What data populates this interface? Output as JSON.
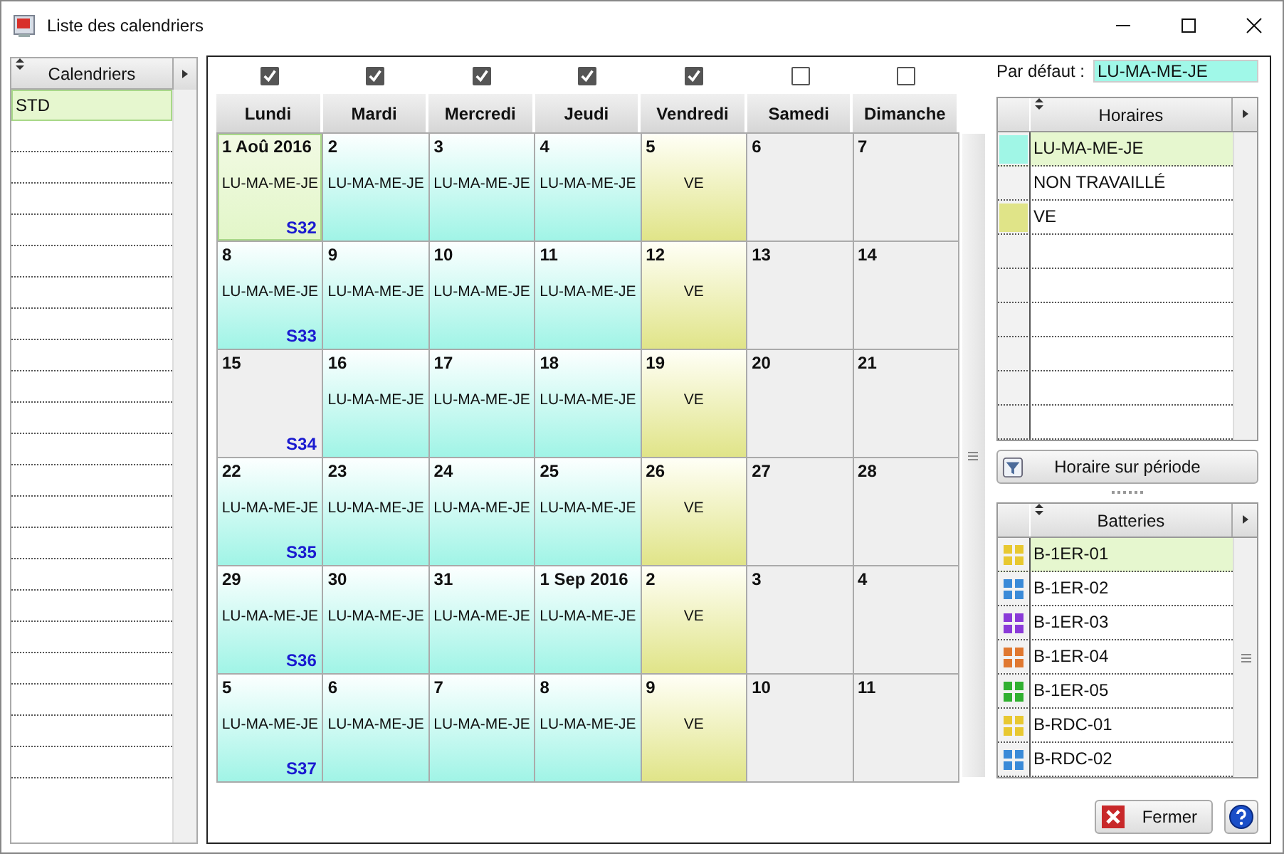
{
  "window": {
    "title": "Liste des calendriers"
  },
  "calendars": {
    "header": "Calendriers",
    "items": [
      {
        "label": "STD",
        "selected": true
      }
    ]
  },
  "weekdays": [
    {
      "label": "Lundi",
      "checked": true
    },
    {
      "label": "Mardi",
      "checked": true
    },
    {
      "label": "Mercredi",
      "checked": true
    },
    {
      "label": "Jeudi",
      "checked": true
    },
    {
      "label": "Vendredi",
      "checked": true
    },
    {
      "label": "Samedi",
      "checked": false
    },
    {
      "label": "Dimanche",
      "checked": false
    }
  ],
  "weeks": [
    {
      "week": "S32",
      "days": [
        {
          "date": "1 Aoû 2016",
          "schedule": "LU-MA-ME-JE",
          "kind": "work",
          "selected": true
        },
        {
          "date": "2",
          "schedule": "LU-MA-ME-JE",
          "kind": "work",
          "selected": false
        },
        {
          "date": "3",
          "schedule": "LU-MA-ME-JE",
          "kind": "work",
          "selected": false
        },
        {
          "date": "4",
          "schedule": "LU-MA-ME-JE",
          "kind": "work",
          "selected": false
        },
        {
          "date": "5",
          "schedule": "VE",
          "kind": "friday",
          "selected": false
        },
        {
          "date": "6",
          "kind": "off",
          "selected": false
        },
        {
          "date": "7",
          "kind": "off",
          "selected": false
        }
      ]
    },
    {
      "week": "S33",
      "days": [
        {
          "date": "8",
          "schedule": "LU-MA-ME-JE",
          "kind": "work",
          "selected": false
        },
        {
          "date": "9",
          "schedule": "LU-MA-ME-JE",
          "kind": "work",
          "selected": false
        },
        {
          "date": "10",
          "schedule": "LU-MA-ME-JE",
          "kind": "work",
          "selected": false
        },
        {
          "date": "11",
          "schedule": "LU-MA-ME-JE",
          "kind": "work",
          "selected": false
        },
        {
          "date": "12",
          "schedule": "VE",
          "kind": "friday",
          "selected": false
        },
        {
          "date": "13",
          "kind": "off",
          "selected": false
        },
        {
          "date": "14",
          "kind": "off",
          "selected": false
        }
      ]
    },
    {
      "week": "S34",
      "days": [
        {
          "date": "15",
          "kind": "off",
          "selected": false
        },
        {
          "date": "16",
          "schedule": "LU-MA-ME-JE",
          "kind": "work",
          "selected": false
        },
        {
          "date": "17",
          "schedule": "LU-MA-ME-JE",
          "kind": "work",
          "selected": false
        },
        {
          "date": "18",
          "schedule": "LU-MA-ME-JE",
          "kind": "work",
          "selected": false
        },
        {
          "date": "19",
          "schedule": "VE",
          "kind": "friday",
          "selected": false
        },
        {
          "date": "20",
          "kind": "off",
          "selected": false
        },
        {
          "date": "21",
          "kind": "off",
          "selected": false
        }
      ]
    },
    {
      "week": "S35",
      "days": [
        {
          "date": "22",
          "schedule": "LU-MA-ME-JE",
          "kind": "work",
          "selected": false
        },
        {
          "date": "23",
          "schedule": "LU-MA-ME-JE",
          "kind": "work",
          "selected": false
        },
        {
          "date": "24",
          "schedule": "LU-MA-ME-JE",
          "kind": "work",
          "selected": false
        },
        {
          "date": "25",
          "schedule": "LU-MA-ME-JE",
          "kind": "work",
          "selected": false
        },
        {
          "date": "26",
          "schedule": "VE",
          "kind": "friday",
          "selected": false
        },
        {
          "date": "27",
          "kind": "off",
          "selected": false
        },
        {
          "date": "28",
          "kind": "off",
          "selected": false
        }
      ]
    },
    {
      "week": "S36",
      "days": [
        {
          "date": "29",
          "schedule": "LU-MA-ME-JE",
          "kind": "work",
          "selected": false
        },
        {
          "date": "30",
          "schedule": "LU-MA-ME-JE",
          "kind": "work",
          "selected": false
        },
        {
          "date": "31",
          "schedule": "LU-MA-ME-JE",
          "kind": "work",
          "selected": false
        },
        {
          "date": "1 Sep 2016",
          "schedule": "LU-MA-ME-JE",
          "kind": "work",
          "selected": false
        },
        {
          "date": "2",
          "schedule": "VE",
          "kind": "friday",
          "selected": false
        },
        {
          "date": "3",
          "kind": "off",
          "selected": false
        },
        {
          "date": "4",
          "kind": "off",
          "selected": false
        }
      ]
    },
    {
      "week": "S37",
      "days": [
        {
          "date": "5",
          "schedule": "LU-MA-ME-JE",
          "kind": "work",
          "selected": false
        },
        {
          "date": "6",
          "schedule": "LU-MA-ME-JE",
          "kind": "work",
          "selected": false
        },
        {
          "date": "7",
          "schedule": "LU-MA-ME-JE",
          "kind": "work",
          "selected": false
        },
        {
          "date": "8",
          "schedule": "LU-MA-ME-JE",
          "kind": "work",
          "selected": false
        },
        {
          "date": "9",
          "schedule": "VE",
          "kind": "friday",
          "selected": false
        },
        {
          "date": "10",
          "kind": "off",
          "selected": false
        },
        {
          "date": "11",
          "kind": "off",
          "selected": false
        }
      ]
    }
  ],
  "default": {
    "label": "Par défaut :",
    "value": "LU-MA-ME-JE"
  },
  "schedules": {
    "header": "Horaires",
    "items": [
      {
        "label": "LU-MA-ME-JE",
        "color": "#a0f6e6",
        "selected": true
      },
      {
        "label": "NON TRAVAILLÉ",
        "selected": false
      },
      {
        "label": "VE",
        "color": "#e0e488",
        "selected": false
      }
    ]
  },
  "period_button": "Horaire sur période",
  "batteries": {
    "header": "Batteries",
    "items": [
      {
        "label": "B-1ER-01",
        "color": "#e8c830",
        "selected": true
      },
      {
        "label": "B-1ER-02",
        "color": "#3a8ad8",
        "selected": false
      },
      {
        "label": "B-1ER-03",
        "color": "#8a3ad8",
        "selected": false
      },
      {
        "label": "B-1ER-04",
        "color": "#e07830",
        "selected": false
      },
      {
        "label": "B-1ER-05",
        "color": "#30b030",
        "selected": false
      },
      {
        "label": "B-RDC-01",
        "color": "#e8c830",
        "selected": false
      },
      {
        "label": "B-RDC-02",
        "color": "#3a8ad8",
        "selected": false
      }
    ]
  },
  "close_button": "Fermer"
}
